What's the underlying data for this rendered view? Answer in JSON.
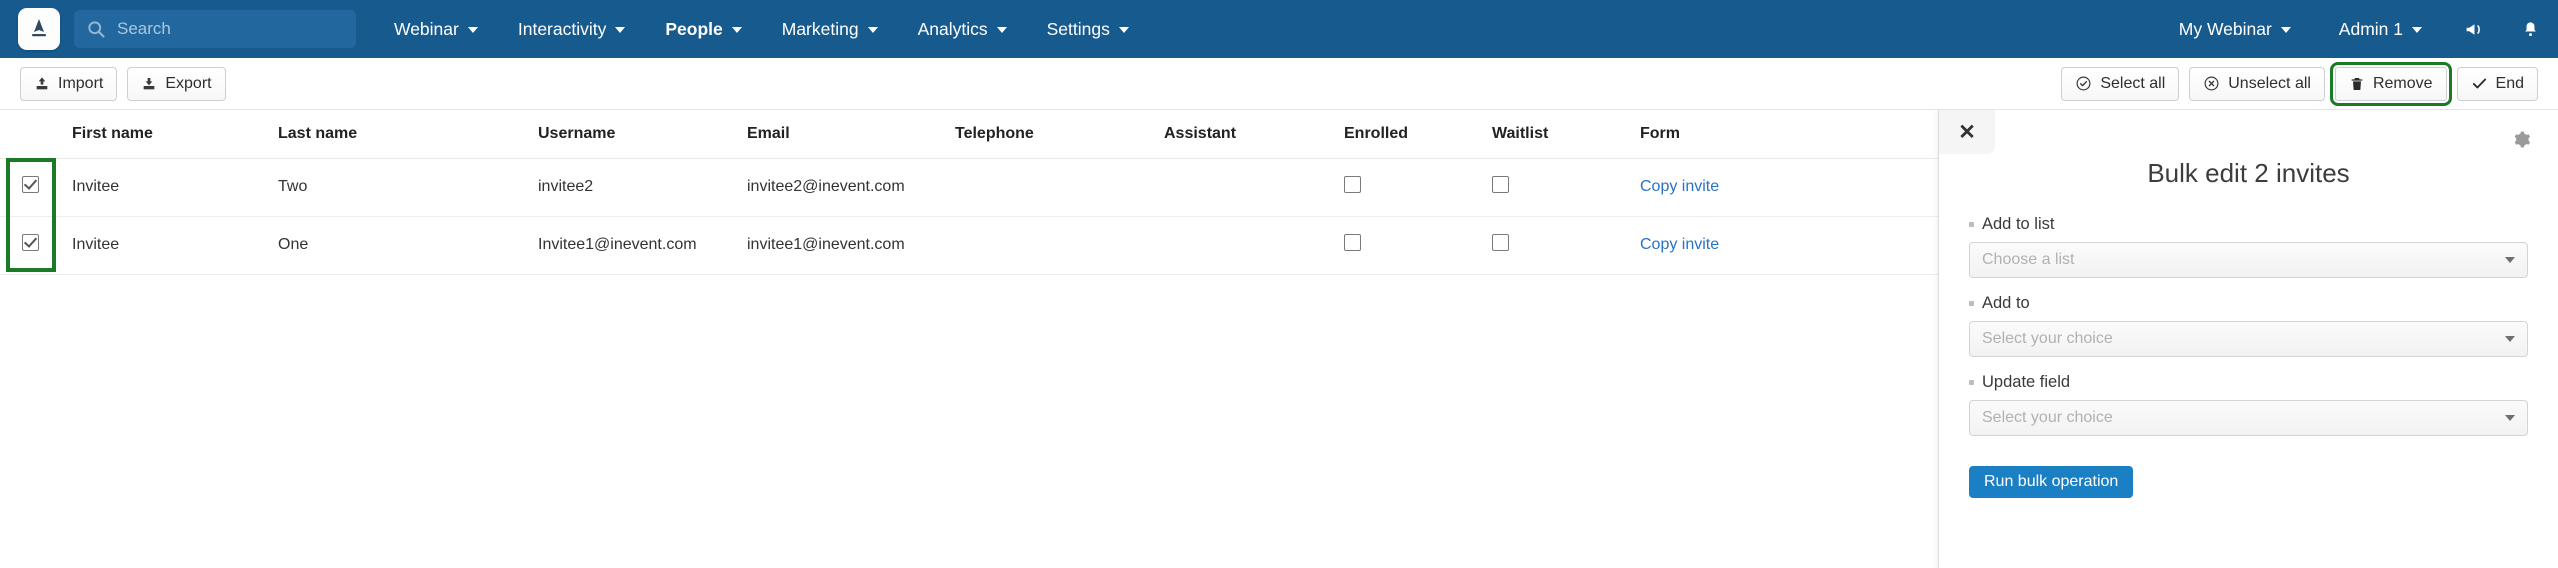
{
  "colors": {
    "header_blue": "#175a8e",
    "search_blue": "#22689e",
    "link_blue": "#2a72c4",
    "primary_blue": "#1b7fc4",
    "highlight_green": "#1a7a26"
  },
  "topbar": {
    "logo_icon": "app-logo-icon",
    "search": {
      "placeholder": "Search",
      "value": "",
      "icon": "search-icon"
    },
    "nav": [
      {
        "label": "Webinar",
        "active": false,
        "has_caret": true
      },
      {
        "label": "Interactivity",
        "active": false,
        "has_caret": true
      },
      {
        "label": "People",
        "active": true,
        "has_caret": true
      },
      {
        "label": "Marketing",
        "active": false,
        "has_caret": true
      },
      {
        "label": "Analytics",
        "active": false,
        "has_caret": true
      },
      {
        "label": "Settings",
        "active": false,
        "has_caret": true
      }
    ],
    "right_nav": [
      {
        "label": "My Webinar",
        "has_caret": true
      },
      {
        "label": "Admin 1",
        "has_caret": true
      }
    ],
    "right_icons": [
      {
        "name": "megaphone-icon"
      },
      {
        "name": "bell-icon"
      }
    ]
  },
  "toolbar": {
    "left": [
      {
        "label": "Import",
        "icon": "import-icon"
      },
      {
        "label": "Export",
        "icon": "export-icon"
      }
    ],
    "right": [
      {
        "label": "Select all",
        "icon": "check-circle-icon",
        "highlighted": false
      },
      {
        "label": "Unselect all",
        "icon": "x-circle-icon",
        "highlighted": false
      },
      {
        "label": "Remove",
        "icon": "trash-icon",
        "highlighted": true
      },
      {
        "label": "End",
        "icon": "check-icon",
        "highlighted": false
      }
    ]
  },
  "table": {
    "columns": [
      "",
      "First name",
      "Last name",
      "Username",
      "Email",
      "Telephone",
      "Assistant",
      "Enrolled",
      "Waitlist",
      "Form"
    ],
    "rows": [
      {
        "selected": true,
        "first_name": "Invitee",
        "last_name": "Two",
        "username": "invitee2",
        "email": "invitee2@inevent.com",
        "telephone": "",
        "assistant": "",
        "enrolled": false,
        "waitlist": false,
        "form_link": "Copy invite"
      },
      {
        "selected": true,
        "first_name": "Invitee",
        "last_name": "One",
        "username": "Invitee1@inevent.com",
        "email": "invitee1@inevent.com",
        "telephone": "",
        "assistant": "",
        "enrolled": false,
        "waitlist": false,
        "form_link": "Copy invite"
      }
    ]
  },
  "panel": {
    "close_label": "✕",
    "gear_icon": "gear-icon",
    "title": "Bulk edit 2 invites",
    "fields": [
      {
        "label": "Add to list",
        "placeholder": "Choose a list",
        "value": ""
      },
      {
        "label": "Add to",
        "placeholder": "Select your choice",
        "value": ""
      },
      {
        "label": "Update field",
        "placeholder": "Select your choice",
        "value": ""
      }
    ],
    "submit_label": "Run bulk operation"
  }
}
